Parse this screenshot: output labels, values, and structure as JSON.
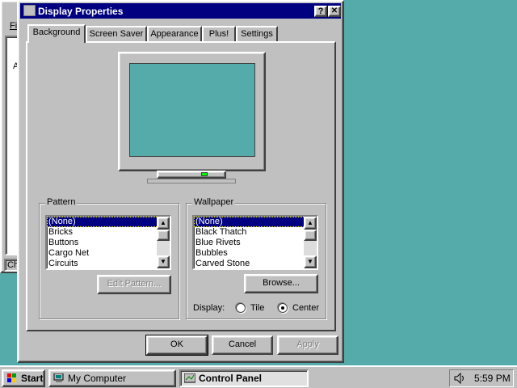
{
  "background_window": {
    "menu_label": "Fil",
    "content_letter": "A",
    "status_text": "Cha"
  },
  "dialog": {
    "title": "Display Properties",
    "help_button": "?",
    "close_button": "✕",
    "tabs": [
      {
        "label": "Background",
        "active": true
      },
      {
        "label": "Screen Saver"
      },
      {
        "label": "Appearance"
      },
      {
        "label": "Plus!"
      },
      {
        "label": "Settings"
      }
    ],
    "pattern": {
      "label": "Pattern",
      "items": [
        "(None)",
        "Bricks",
        "Buttons",
        "Cargo Net",
        "Circuits"
      ],
      "selected_index": 0,
      "edit_button": "Edit Pattern..."
    },
    "wallpaper": {
      "label": "Wallpaper",
      "items": [
        "(None)",
        "Black Thatch",
        "Blue Rivets",
        "Bubbles",
        "Carved Stone"
      ],
      "selected_index": 0,
      "browse_button": "Browse...",
      "display_label": "Display:",
      "tile_label": "Tile",
      "center_label": "Center",
      "selected_display": "Center"
    },
    "buttons": {
      "ok": "OK",
      "cancel": "Cancel",
      "apply": "Apply"
    },
    "colors": {
      "titlebar": "#000080",
      "desktop": "#55aaaa",
      "face": "#c0c0c0"
    }
  },
  "taskbar": {
    "start_label": "Start",
    "tasks": [
      {
        "label": "My Computer",
        "icon": "my-computer-icon",
        "active": false
      },
      {
        "label": "Control Panel",
        "icon": "control-panel-icon",
        "active": true
      }
    ],
    "clock": "5:59 PM",
    "tray_icon": "volume-icon"
  }
}
